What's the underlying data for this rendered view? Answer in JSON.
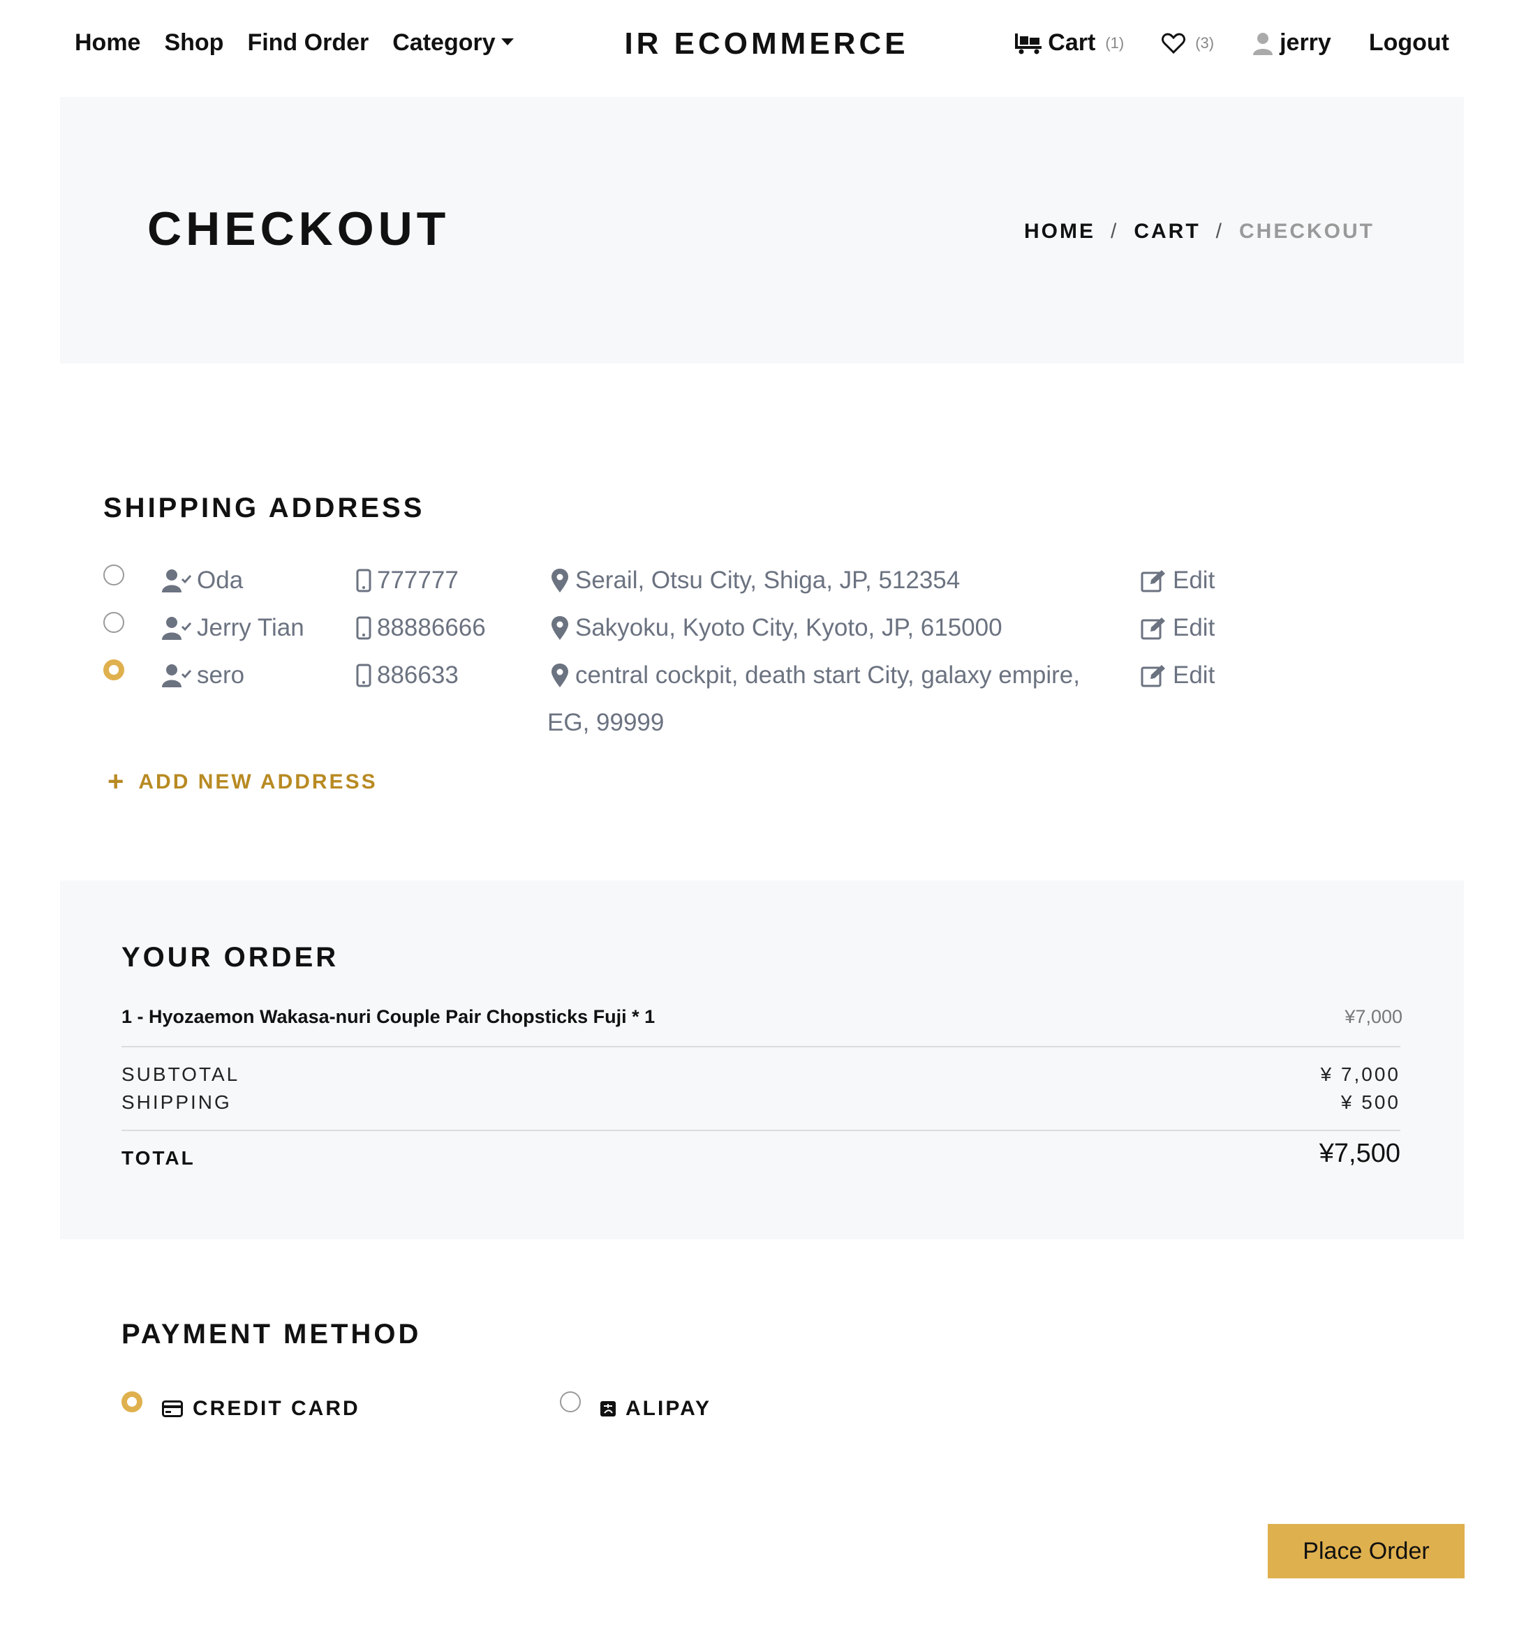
{
  "nav": {
    "links": [
      "Home",
      "Shop",
      "Find Order",
      "Category"
    ],
    "brand": "IR ECOMMERCE",
    "cart_label": "Cart",
    "cart_count": "(1)",
    "wishlist_count": "(3)",
    "user": "jerry",
    "logout": "Logout"
  },
  "hero": {
    "title": "CHECKOUT",
    "breadcrumbs": [
      "HOME",
      "CART",
      "CHECKOUT"
    ],
    "sep": "/"
  },
  "shipping": {
    "title": "SHIPPING ADDRESS",
    "addresses": [
      {
        "name": "Oda",
        "phone": "777777",
        "address": "Serail, Otsu City, Shiga, JP, 512354",
        "address_cont": "",
        "selected": false,
        "edit": "Edit"
      },
      {
        "name": "Jerry Tian",
        "phone": "88886666",
        "address": "Sakyoku, Kyoto City, Kyoto, JP, 615000",
        "address_cont": "",
        "selected": false,
        "edit": "Edit"
      },
      {
        "name": "sero",
        "phone": "886633",
        "address": "central cockpit, death start City, galaxy empire,",
        "address_cont": "EG, 99999",
        "selected": true,
        "edit": "Edit"
      }
    ],
    "add_new": "ADD NEW ADDRESS"
  },
  "order": {
    "title": "YOUR ORDER",
    "item": "1 - Hyozaemon Wakasa-nuri Couple Pair Chopsticks Fuji * 1",
    "item_price": "¥7,000",
    "subtotal_label": "SUBTOTAL",
    "subtotal": "¥ 7,000",
    "shipping_label": "SHIPPING",
    "shipping": "¥ 500",
    "total_label": "TOTAL",
    "total": "¥7,500"
  },
  "payment": {
    "title": "PAYMENT METHOD",
    "methods": [
      {
        "label": "CREDIT CARD",
        "selected": true
      },
      {
        "label": "ALIPAY",
        "selected": false
      }
    ]
  },
  "place_order": "Place Order",
  "colors": {
    "accent": "#dfb04e",
    "link": "#b88a22",
    "panel": "#f7f8fa",
    "muted": "#6b7280"
  }
}
